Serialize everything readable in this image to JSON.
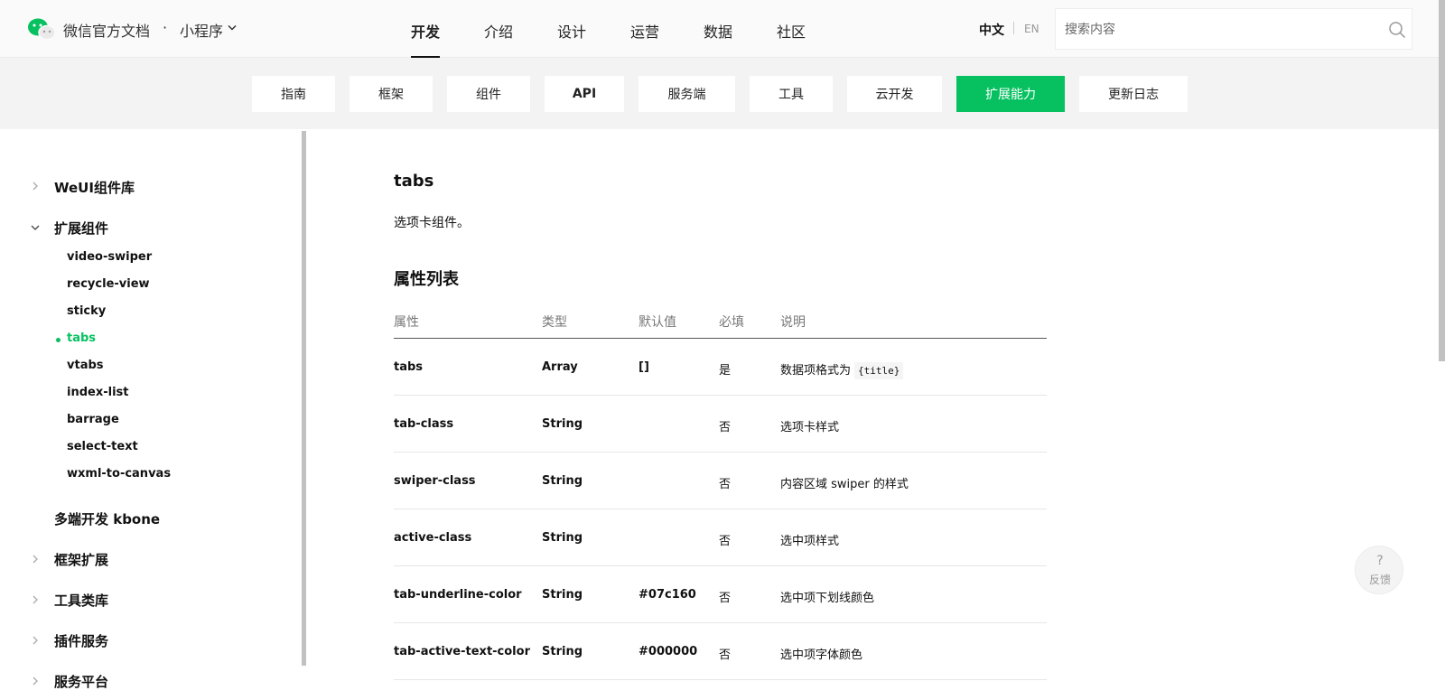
{
  "header": {
    "site_title": "微信官方文档",
    "separator": "·",
    "product": "小程序",
    "nav": [
      {
        "label": "开发",
        "active": true
      },
      {
        "label": "介绍",
        "active": false
      },
      {
        "label": "设计",
        "active": false
      },
      {
        "label": "运营",
        "active": false
      },
      {
        "label": "数据",
        "active": false
      },
      {
        "label": "社区",
        "active": false
      }
    ],
    "lang_zh": "中文",
    "lang_en": "EN",
    "search_placeholder": "搜索内容"
  },
  "subnav": [
    {
      "label": "指南",
      "active": false
    },
    {
      "label": "框架",
      "active": false
    },
    {
      "label": "组件",
      "active": false
    },
    {
      "label": "API",
      "active": false
    },
    {
      "label": "服务端",
      "active": false
    },
    {
      "label": "工具",
      "active": false
    },
    {
      "label": "云开发",
      "active": false
    },
    {
      "label": "扩展能力",
      "active": true
    },
    {
      "label": "更新日志",
      "active": false
    }
  ],
  "sidebar": {
    "items": [
      {
        "label": "WeUI组件库",
        "state": "collapsed"
      },
      {
        "label": "扩展组件",
        "state": "expanded"
      },
      {
        "label": "多端开发 kbone",
        "state": "none"
      },
      {
        "label": "框架扩展",
        "state": "collapsed"
      },
      {
        "label": "工具类库",
        "state": "collapsed"
      },
      {
        "label": "插件服务",
        "state": "collapsed"
      },
      {
        "label": "服务平台",
        "state": "collapsed"
      }
    ],
    "subitems": [
      {
        "label": "video-swiper"
      },
      {
        "label": "recycle-view"
      },
      {
        "label": "sticky"
      },
      {
        "label": "tabs",
        "active": true
      },
      {
        "label": "vtabs"
      },
      {
        "label": "index-list"
      },
      {
        "label": "barrage"
      },
      {
        "label": "select-text"
      },
      {
        "label": "wxml-to-canvas"
      }
    ]
  },
  "content": {
    "title": "tabs",
    "description": "选项卡组件。",
    "section_title": "属性列表",
    "table": {
      "headers": [
        "属性",
        "类型",
        "默认值",
        "必填",
        "说明"
      ],
      "rows": [
        {
          "attr": "tabs",
          "type": "Array",
          "default": "[]",
          "required": "是",
          "desc": "数据项格式为",
          "code": "{title}"
        },
        {
          "attr": "tab-class",
          "type": "String",
          "default": "",
          "required": "否",
          "desc": "选项卡样式",
          "code": ""
        },
        {
          "attr": "swiper-class",
          "type": "String",
          "default": "",
          "required": "否",
          "desc": "内容区域 swiper 的样式",
          "code": ""
        },
        {
          "attr": "active-class",
          "type": "String",
          "default": "",
          "required": "否",
          "desc": "选中项样式",
          "code": ""
        },
        {
          "attr": "tab-underline-color",
          "type": "String",
          "default": "#07c160",
          "required": "否",
          "desc": "选中项下划线颜色",
          "code": ""
        },
        {
          "attr": "tab-active-text-color",
          "type": "String",
          "default": "#000000",
          "required": "否",
          "desc": "选中项字体颜色",
          "code": ""
        }
      ]
    }
  },
  "feedback": {
    "icon": "?",
    "label": "反馈"
  },
  "colors": {
    "accent": "#07c160"
  }
}
